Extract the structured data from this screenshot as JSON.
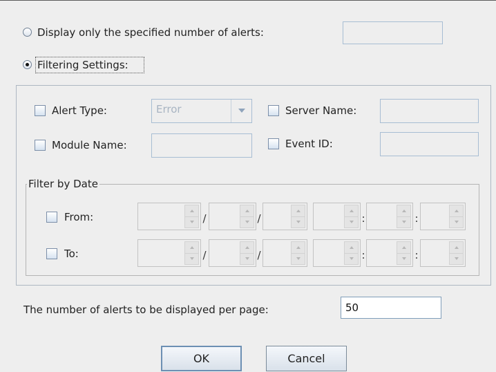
{
  "display_only": {
    "label": "Display only the specified number of alerts:",
    "value": "",
    "selected": false
  },
  "filtering": {
    "label": "Filtering Settings:",
    "selected": true
  },
  "alert_type": {
    "label": "Alert Type:",
    "checked": false,
    "selected_value": "Error"
  },
  "server_name": {
    "label": "Server Name:",
    "checked": false,
    "value": ""
  },
  "module_name": {
    "label": "Module Name:",
    "checked": false,
    "value": ""
  },
  "event_id": {
    "label": "Event ID:",
    "checked": false,
    "value": ""
  },
  "date_filter": {
    "title": "Filter by Date",
    "from": {
      "label": "From:",
      "checked": false
    },
    "to": {
      "label": "To:",
      "checked": false
    },
    "separators": [
      "/",
      "/",
      "",
      ":",
      ":"
    ]
  },
  "per_page": {
    "label": "The number of alerts to be displayed per page:",
    "value": "50"
  },
  "buttons": {
    "ok": "OK",
    "cancel": "Cancel"
  }
}
